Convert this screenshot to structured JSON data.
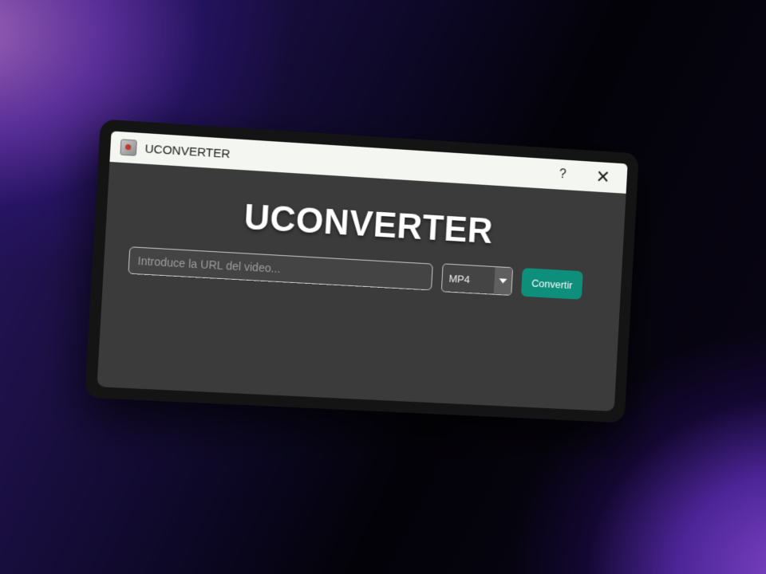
{
  "window": {
    "title": "UCONVERTER",
    "help_label": "?",
    "close_label": "✕"
  },
  "main": {
    "heading": "UCONVERTER",
    "url_input": {
      "placeholder": "Introduce la URL del video...",
      "value": ""
    },
    "format_select": {
      "selected": "MP4"
    },
    "convert_button": "Convertir"
  },
  "colors": {
    "accent": "#0e8f7b",
    "window_bg": "#3b3b3b",
    "titlebar_bg": "#f4f6f2"
  },
  "icons": {
    "app": "app-icon",
    "help": "help-icon",
    "close": "close-icon",
    "dropdown": "chevron-down-icon"
  }
}
